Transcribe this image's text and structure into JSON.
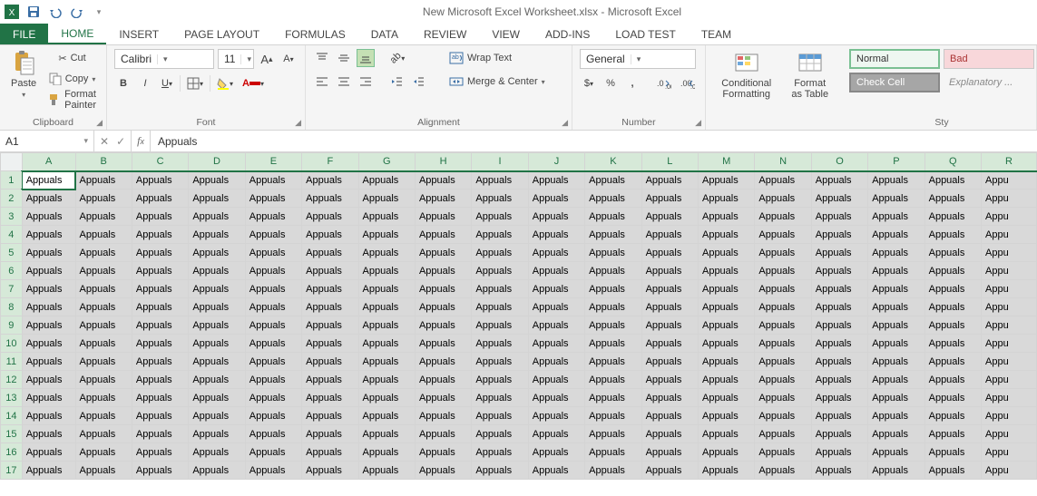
{
  "title": "New Microsoft Excel Worksheet.xlsx - Microsoft Excel",
  "tabs": {
    "file": "FILE",
    "home": "HOME",
    "insert": "INSERT",
    "page_layout": "PAGE LAYOUT",
    "formulas": "FORMULAS",
    "data": "DATA",
    "review": "REVIEW",
    "view": "VIEW",
    "addins": "ADD-INS",
    "loadtest": "LOAD TEST",
    "team": "TEAM"
  },
  "clipboard": {
    "paste": "Paste",
    "cut": "Cut",
    "copy": "Copy",
    "format_painter": "Format Painter",
    "label": "Clipboard"
  },
  "font": {
    "name": "Calibri",
    "size": "11",
    "label": "Font"
  },
  "alignment": {
    "wrap": "Wrap Text",
    "merge": "Merge & Center",
    "label": "Alignment"
  },
  "number": {
    "format": "General",
    "label": "Number"
  },
  "cond_format": "Conditional Formatting",
  "format_table": "Format as Table",
  "styles": {
    "normal": "Normal",
    "bad": "Bad",
    "check": "Check Cell",
    "expl": "Explanatory ...",
    "label": "Sty"
  },
  "namebox": "A1",
  "formula": "Appuals",
  "columns": [
    "A",
    "B",
    "C",
    "D",
    "E",
    "F",
    "G",
    "H",
    "I",
    "J",
    "K",
    "L",
    "M",
    "N",
    "O",
    "P",
    "Q",
    "R"
  ],
  "rows": [
    1,
    2,
    3,
    4,
    5,
    6,
    7,
    8,
    9,
    10,
    11,
    12,
    13,
    14,
    15,
    16,
    17
  ],
  "cell_value": "Appuals",
  "cell_value_last": "Appu"
}
